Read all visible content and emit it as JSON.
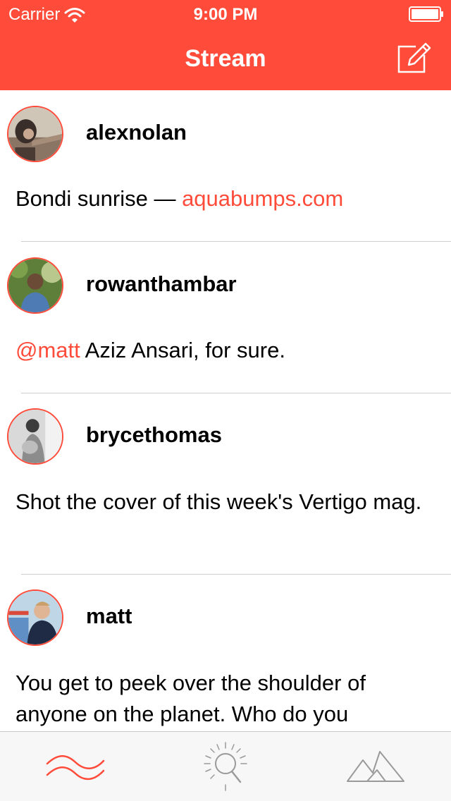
{
  "status_bar": {
    "carrier": "Carrier",
    "time": "9:00 PM"
  },
  "nav": {
    "title": "Stream",
    "compose_icon": "compose-icon"
  },
  "posts": [
    {
      "username": "alexnolan",
      "text_before": "Bondi sunrise — ",
      "link": "aquabumps.com",
      "text_after": ""
    },
    {
      "username": "rowanthambar",
      "mention": "@matt",
      "text_after": " Aziz Ansari, for sure."
    },
    {
      "username": "brycethomas",
      "text": "Shot the cover of this week's Vertigo mag."
    },
    {
      "username": "matt",
      "text": "You get to peek over the shoulder of anyone on the planet. Who do you"
    }
  ],
  "tabs": [
    {
      "icon": "stream-waves-icon",
      "active": true
    },
    {
      "icon": "explore-sun-search-icon",
      "active": false
    },
    {
      "icon": "mountains-icon",
      "active": false
    }
  ],
  "colors": {
    "accent": "#ff4b3a",
    "tab_inactive": "#9a9a9a",
    "divider": "#cfcfcf"
  }
}
